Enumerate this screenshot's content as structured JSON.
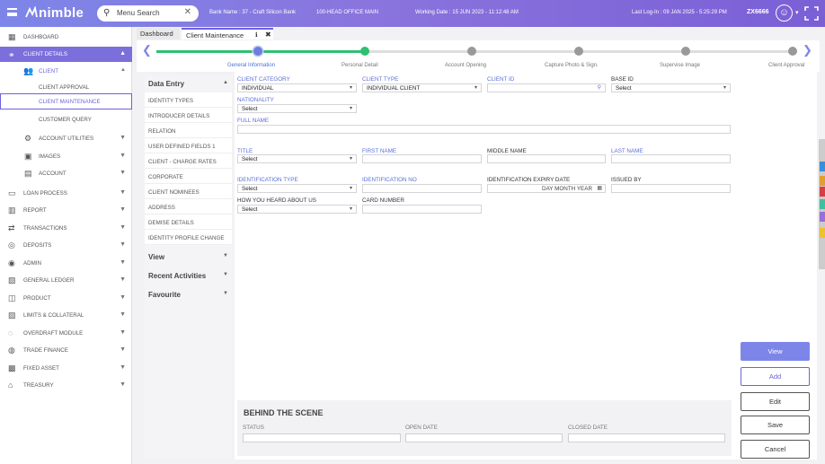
{
  "topbar": {
    "logo": "nimble",
    "search_placeholder": "Menu Search",
    "bank_name": "Bank Name : 37 - Craft Silicon Bank",
    "branch": "100-HEAD OFFICE MAIN",
    "working_date": "Working Date : 15 JUN 2023 - 11:12:48 AM",
    "last_login": "Last Log-In : 09 JAN 2025 - 5:25:29 PM",
    "user": "ZX6666"
  },
  "sidebar": {
    "items": [
      {
        "label": "DASHBOARD",
        "icon": "dashboard-icon",
        "glyph": "▦"
      },
      {
        "label": "CLIENT DETAILS",
        "icon": "client-details-icon",
        "glyph": "⚭"
      },
      {
        "label": "CLIENT",
        "icon": "client-icon",
        "glyph": "👥"
      },
      {
        "label": "CLIENT APPROVAL"
      },
      {
        "label": "CLIENT MAINTENANCE"
      },
      {
        "label": "CUSTOMER QUERY"
      },
      {
        "label": "ACCOUNT UTILITIES",
        "icon": "account-utilities-icon",
        "glyph": "⚙"
      },
      {
        "label": "IMAGES",
        "icon": "images-icon",
        "glyph": "▣"
      },
      {
        "label": "ACCOUNT",
        "icon": "account-icon",
        "glyph": "▤"
      },
      {
        "label": "LOAN PROCESS",
        "icon": "loan-icon",
        "glyph": "▭"
      },
      {
        "label": "REPORT",
        "icon": "report-icon",
        "glyph": "▥"
      },
      {
        "label": "TRANSACTIONS",
        "icon": "transactions-icon",
        "glyph": "⇄"
      },
      {
        "label": "DEPOSITS",
        "icon": "deposits-icon",
        "glyph": "◎"
      },
      {
        "label": "ADMIN",
        "icon": "admin-icon",
        "glyph": "◉"
      },
      {
        "label": "GENERAL LEDGER",
        "icon": "ledger-icon",
        "glyph": "▧"
      },
      {
        "label": "PRODUCT",
        "icon": "product-icon",
        "glyph": "◫"
      },
      {
        "label": "LIMITS & COLLATERAL",
        "icon": "limits-icon",
        "glyph": "▨"
      },
      {
        "label": "OVERDRAFT MODULE",
        "icon": "overdraft-icon",
        "glyph": "◌"
      },
      {
        "label": "TRADE FINANCE",
        "icon": "trade-icon",
        "glyph": "◍"
      },
      {
        "label": "FIXED ASSET",
        "icon": "fixed-asset-icon",
        "glyph": "▩"
      },
      {
        "label": "TREASURY",
        "icon": "treasury-icon",
        "glyph": "⌂"
      }
    ]
  },
  "tabs": {
    "dashboard": "Dashboard",
    "client_maintenance": "Client Maintenance"
  },
  "stepper": {
    "steps": [
      "General Information",
      "Personal Detail",
      "Account Opening",
      "Capture Photo & Sign.",
      "Supervise Image",
      "Client Approval"
    ]
  },
  "left_panel": {
    "data_entry": "Data Entry",
    "items": [
      "IDENTITY TYPES",
      "INTRODUCER DETAILS",
      "RELATION",
      "USER DEFINED FIELDS 1",
      "CLIENT - CHARGE RATES",
      "CORPORATE",
      "CLIENT NOMINEES",
      "ADDRESS",
      "DEMISE DETAILS",
      "IDENTITY PROFILE CHANGE"
    ],
    "view": "View",
    "recent": "Recent Activities",
    "favourite": "Favourite"
  },
  "form": {
    "client_category": {
      "label": "CLIENT CATEGORY",
      "value": "INDIVIDUAL"
    },
    "client_type": {
      "label": "CLIENT TYPE",
      "value": "INDIVIDUAL CLIENT"
    },
    "client_id": {
      "label": "CLIENT ID",
      "value": ""
    },
    "base_id": {
      "label": "BASE ID",
      "value": "Select"
    },
    "nationality": {
      "label": "NATIONALITY",
      "value": "Select"
    },
    "full_name": {
      "label": "FULL NAME",
      "value": ""
    },
    "title": {
      "label": "TITLE",
      "value": "Select"
    },
    "first_name": {
      "label": "FIRST NAME",
      "value": ""
    },
    "middle_name": {
      "label": "MIDDLE NAME",
      "value": ""
    },
    "last_name": {
      "label": "LAST NAME",
      "value": ""
    },
    "identification_type": {
      "label": "IDENTIFICATION TYPE",
      "value": "Select"
    },
    "identification_no": {
      "label": "IDENTIFICATION NO",
      "value": ""
    },
    "identification_expiry": {
      "label": "IDENTIFICATION EXPIRY DATE",
      "placeholder": "DAY MONTH YEAR"
    },
    "issued_by": {
      "label": "ISSUED BY",
      "value": ""
    },
    "how_heard": {
      "label": "HOW YOU HEARD ABOUT US",
      "value": "Select"
    },
    "card_number": {
      "label": "CARD NUMBER",
      "value": ""
    }
  },
  "behind": {
    "title": "BEHIND THE SCENE",
    "status": "STATUS",
    "open_date": "OPEN DATE",
    "closed_date": "CLOSED DATE"
  },
  "buttons": {
    "view": "View",
    "add": "Add",
    "edit": "Edit",
    "save": "Save",
    "cancel": "Cancel"
  },
  "colors": {
    "accent": "#7d86e8",
    "done": "#2fbf71",
    "label": "#5a6fd8"
  }
}
